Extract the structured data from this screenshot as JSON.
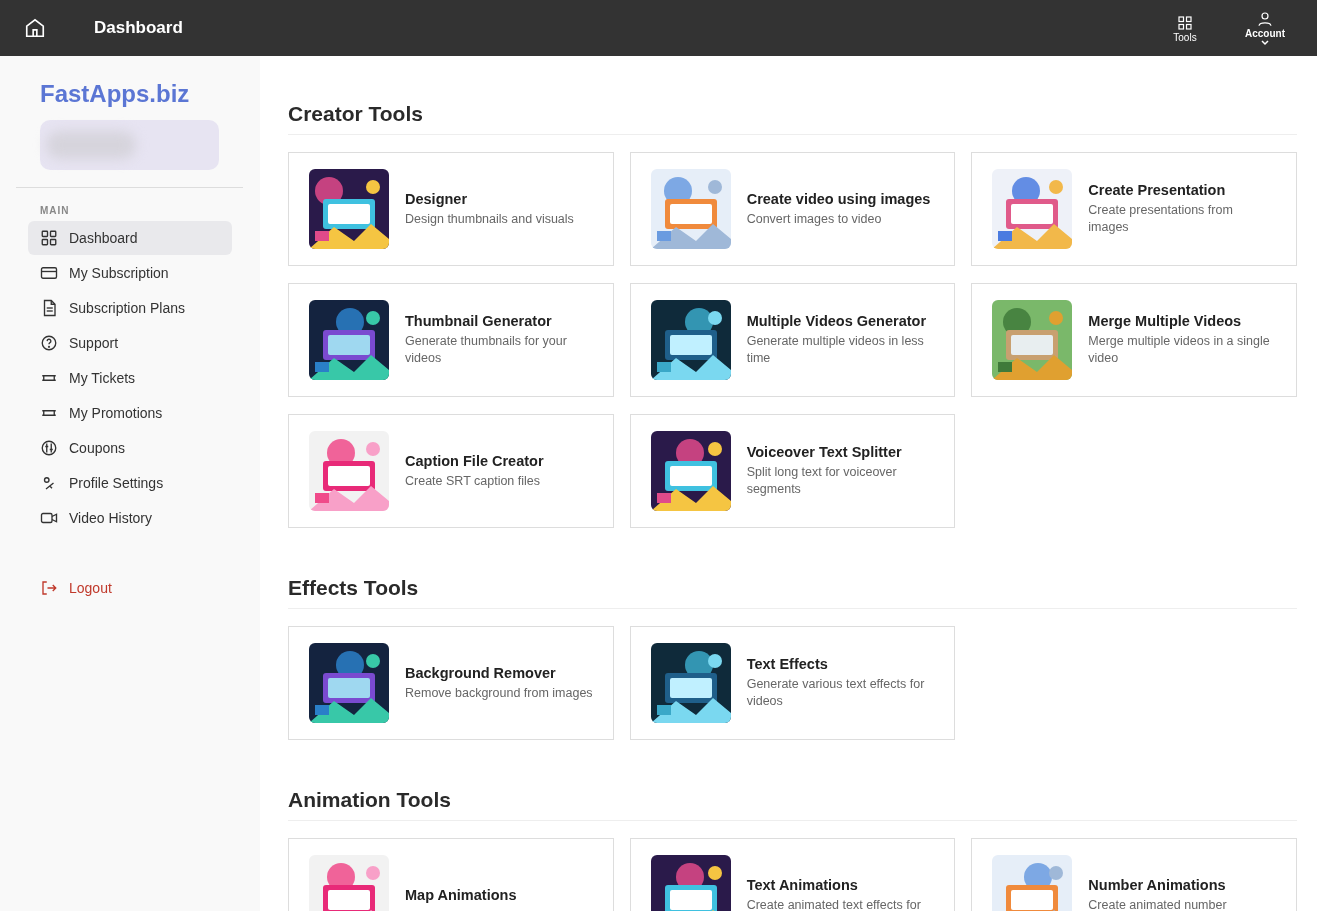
{
  "top_bar": {
    "title": "Dashboard",
    "actions": [
      {
        "label": "Tools"
      },
      {
        "label": "Account"
      }
    ]
  },
  "sidebar": {
    "brand": "FastApps.biz",
    "section_label": "MAIN",
    "items": [
      {
        "label": "Dashboard",
        "selected": true
      },
      {
        "label": "My Subscription",
        "selected": false
      },
      {
        "label": "Subscription Plans",
        "selected": false
      },
      {
        "label": "Support",
        "selected": false
      },
      {
        "label": "My Tickets",
        "selected": false
      },
      {
        "label": "My Promotions",
        "selected": false
      },
      {
        "label": "Coupons",
        "selected": false
      },
      {
        "label": "Profile Settings",
        "selected": false
      },
      {
        "label": "Video History",
        "selected": false
      }
    ],
    "logout": "Logout"
  },
  "sections": [
    {
      "title": "Creator Tools",
      "tools": [
        {
          "title": "Designer",
          "description": "Design thumbnails and visuals"
        },
        {
          "title": "Create video using images",
          "description": "Convert images to video"
        },
        {
          "title": "Create Presentation",
          "description": "Create presentations from images"
        },
        {
          "title": "Thumbnail Generator",
          "description": "Generate thumbnails for your videos"
        },
        {
          "title": "Multiple Videos Generator",
          "description": "Generate multiple videos in less time"
        },
        {
          "title": "Merge Multiple Videos",
          "description": "Merge multiple videos in a single video"
        },
        {
          "title": "Caption File Creator",
          "description": "Create SRT caption files"
        },
        {
          "title": "Voiceover Text Splitter",
          "description": "Split long text for voiceover segments"
        }
      ]
    },
    {
      "title": "Effects Tools",
      "tools": [
        {
          "title": "Background Remover",
          "description": "Remove background from images"
        },
        {
          "title": "Text Effects",
          "description": "Generate various text effects for videos"
        }
      ]
    },
    {
      "title": "Animation Tools",
      "tools": [
        {
          "title": "Map Animations"
        },
        {
          "title": "Text Animations",
          "description": "Create animated text effects for"
        },
        {
          "title": "Number Animations",
          "description": "Create animated number"
        }
      ]
    }
  ]
}
